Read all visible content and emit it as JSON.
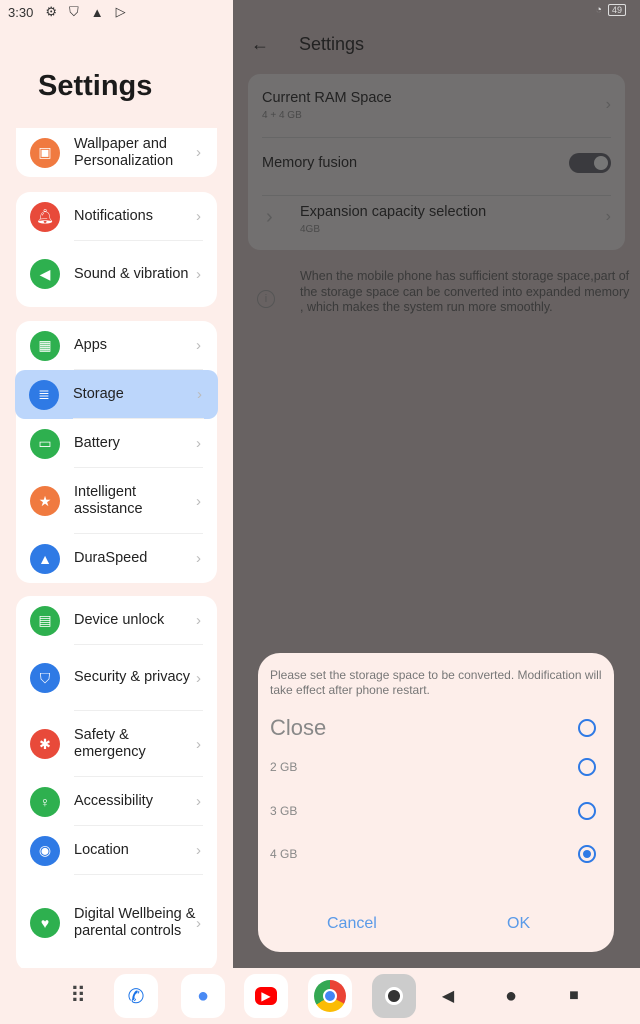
{
  "status": {
    "time": "3:30",
    "battery": "49"
  },
  "left": {
    "title": "Settings",
    "groups": [
      [
        {
          "label": "Wallpaper and Personalization",
          "icon": "wallpaper-icon",
          "color": "#f07a40"
        }
      ],
      [
        {
          "label": "Notifications",
          "icon": "bell-icon",
          "color": "#e84a3a"
        },
        {
          "label": "Sound & vibration",
          "icon": "speaker-icon",
          "color": "#2eb04f"
        }
      ],
      [
        {
          "label": "Apps",
          "icon": "apps-grid-icon",
          "color": "#2eb04f"
        },
        {
          "label": "Storage",
          "icon": "storage-icon",
          "color": "#2f7ae5"
        },
        {
          "label": "Battery",
          "icon": "battery-icon",
          "color": "#2eb04f"
        },
        {
          "label": "Intelligent assistance",
          "icon": "star-icon",
          "color": "#f07a40"
        },
        {
          "label": "DuraSpeed",
          "icon": "rocket-icon",
          "color": "#2f7ae5"
        }
      ],
      [
        {
          "label": "Device unlock",
          "icon": "lock-icon",
          "color": "#2eb04f"
        },
        {
          "label": "Security & privacy",
          "icon": "shield-icon",
          "color": "#2f7ae5"
        },
        {
          "label": "Safety & emergency",
          "icon": "asterisk-icon",
          "color": "#e84a3a"
        },
        {
          "label": "Accessibility",
          "icon": "accessibility-icon",
          "color": "#2eb04f"
        },
        {
          "label": "Location",
          "icon": "location-icon",
          "color": "#2f7ae5"
        },
        {
          "label": "Digital Wellbeing & parental controls",
          "icon": "wellbeing-icon",
          "color": "#2eb04f"
        }
      ]
    ]
  },
  "right": {
    "title": "Settings",
    "ram_label": "Current RAM Space",
    "ram_value": "4 + 4 GB",
    "fusion_label": "Memory fusion",
    "fusion_on": true,
    "expansion_label": "Expansion capacity selection",
    "expansion_value": "4GB",
    "info": "When the mobile phone has sufficient storage space,part of the storage space can be converted into expanded memory , which makes the system run more smoothly."
  },
  "dialog": {
    "message": "Please set the storage space to be converted. Modification will take effect after phone restart.",
    "options": [
      {
        "label": "Close",
        "selected": false
      },
      {
        "label": "2 GB",
        "selected": false
      },
      {
        "label": "3 GB",
        "selected": false
      },
      {
        "label": "4 GB",
        "selected": true
      }
    ],
    "cancel": "Cancel",
    "ok": "OK"
  },
  "colors": {
    "accent": "#2f7ae5",
    "selected_bg": "#bcd6fb"
  }
}
